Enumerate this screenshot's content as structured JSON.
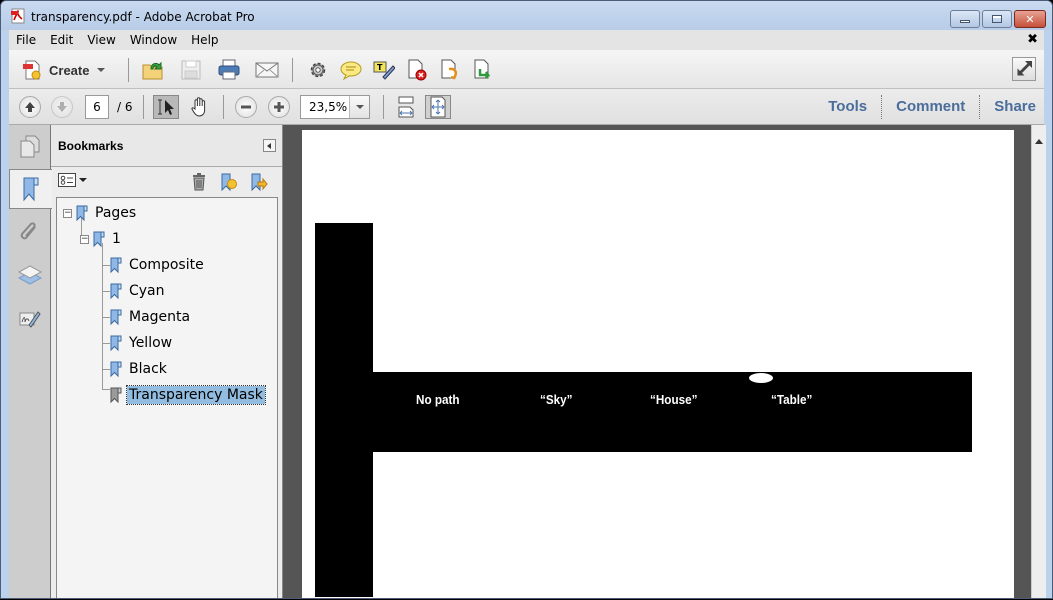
{
  "window": {
    "title": "transparency.pdf - Adobe Acrobat Pro",
    "controls": {
      "minimize": "minimize",
      "maximize": "restore",
      "close": "close"
    }
  },
  "menubar": {
    "items": [
      "File",
      "Edit",
      "View",
      "Window",
      "Help"
    ],
    "close_doc_glyph": "✖"
  },
  "toolbar": {
    "create_label": "Create",
    "icons": [
      "open-folder-icon",
      "save-icon",
      "print-icon",
      "email-icon",
      "gear-icon",
      "comment-bubble-icon",
      "text-edit-icon",
      "delete-page-icon",
      "rotate-page-icon",
      "extract-page-icon"
    ],
    "expand_icon": "expand-icon"
  },
  "navbar": {
    "current_page": "6",
    "total_pages": "/ 6",
    "zoom_value": "23,5%",
    "links": [
      "Tools",
      "Comment",
      "Share"
    ]
  },
  "leftnav": {
    "icons": [
      "page-thumbnails-icon",
      "bookmarks-icon",
      "attachments-icon",
      "layers-icon",
      "signatures-icon"
    ],
    "selected": "bookmarks-icon"
  },
  "bookmarks": {
    "title": "Bookmarks",
    "tree": [
      {
        "label": "Pages",
        "level": 0,
        "expanded": true
      },
      {
        "label": "1",
        "level": 1,
        "expanded": true
      },
      {
        "label": "Composite",
        "level": 2
      },
      {
        "label": "Cyan",
        "level": 2
      },
      {
        "label": "Magenta",
        "level": 2
      },
      {
        "label": "Yellow",
        "level": 2
      },
      {
        "label": "Black",
        "level": 2
      },
      {
        "label": "Transparency Mask",
        "level": 2,
        "selected": true
      }
    ]
  },
  "document": {
    "labels": [
      "No path",
      "“Sky”",
      "“House”",
      "“Table”"
    ]
  },
  "colors": {
    "link": "#4a6d9b",
    "selection": "#92bde0",
    "doc_bg": "#555555",
    "frame": "#bcd1ec"
  }
}
